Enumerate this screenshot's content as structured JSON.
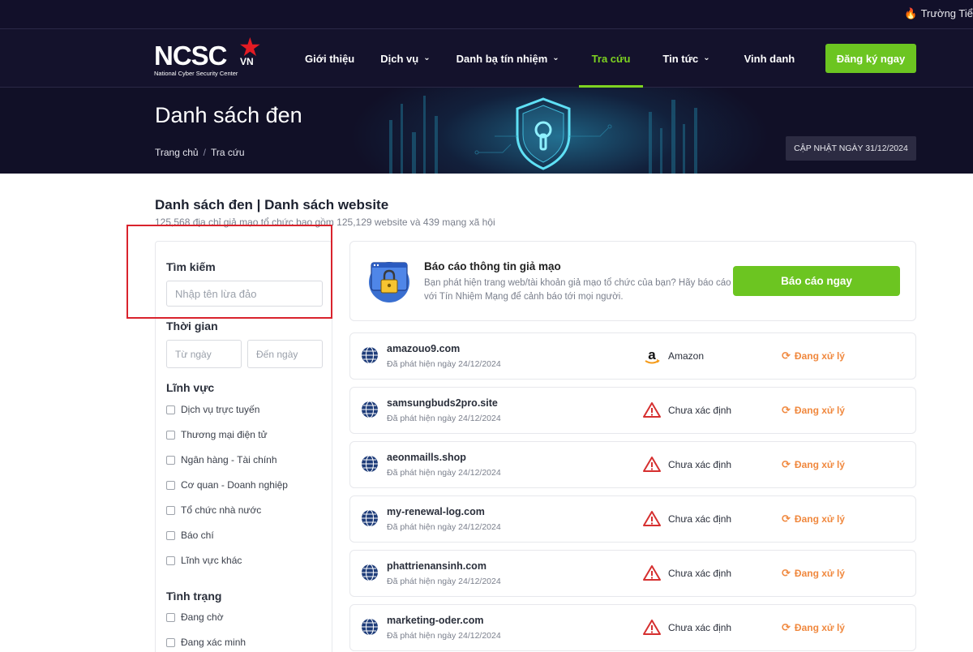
{
  "ticker": {
    "text": "Trường Tiể"
  },
  "logo": {
    "brand": "NCSC",
    "suffix": "VN",
    "tagline": "National Cyber Security Center"
  },
  "nav": {
    "items": [
      {
        "label": "Giới thiệu",
        "has_dropdown": false,
        "active": false
      },
      {
        "label": "Dịch vụ",
        "has_dropdown": true,
        "active": false
      },
      {
        "label": "Danh bạ tín nhiệm",
        "has_dropdown": true,
        "active": false
      },
      {
        "label": "Tra cứu",
        "has_dropdown": false,
        "active": true
      },
      {
        "label": "Tin tức",
        "has_dropdown": true,
        "active": false
      },
      {
        "label": "Vinh danh",
        "has_dropdown": false,
        "active": false
      }
    ],
    "signup_label": "Đăng ký ngay"
  },
  "hero": {
    "title": "Danh sách đen",
    "breadcrumb": [
      "Trang chủ",
      "/",
      "Tra cứu"
    ],
    "update_badge": "CẬP NHẬT NGÀY 31/12/2024"
  },
  "section": {
    "title": "Danh sách đen | Danh sách website",
    "subtitle": "125,568 địa chỉ giả mạo tổ chức bao gồm 125,129 website và 439 mạng xã hội"
  },
  "filters": {
    "search_label": "Tìm kiếm",
    "search_placeholder": "Nhập tên lừa đảo",
    "time_label": "Thời gian",
    "from_placeholder": "Từ ngày",
    "to_placeholder": "Đến ngày",
    "field_label": "Lĩnh vực",
    "fields": [
      "Dịch vụ trực tuyến",
      "Thương mại điện tử",
      "Ngân hàng - Tài chính",
      "Cơ quan - Doanh nghiệp",
      "Tổ chức nhà nước",
      "Báo chí",
      "Lĩnh vực khác"
    ],
    "status_label": "Tình trạng",
    "statuses": [
      "Đang chờ",
      "Đang xác minh"
    ]
  },
  "report": {
    "title": "Báo cáo thông tin giả mạo",
    "description": "Bạn phát hiện trang web/tài khoản giả mạo tổ chức của bạn? Hãy báo cáo với Tín Nhiệm Mạng để cảnh báo tới mọi người.",
    "button": "Báo cáo ngay"
  },
  "entries": [
    {
      "domain": "amazouo9.com",
      "date": "Đã phát hiện ngày 24/12/2024",
      "org": "Amazon",
      "org_icon": "amazon-icon",
      "status": "Đang xử lý"
    },
    {
      "domain": "samsungbuds2pro.site",
      "date": "Đã phát hiện ngày 24/12/2024",
      "org": "Chưa xác định",
      "org_icon": "warning-icon",
      "status": "Đang xử lý"
    },
    {
      "domain": "aeonmaills.shop",
      "date": "Đã phát hiện ngày 24/12/2024",
      "org": "Chưa xác định",
      "org_icon": "warning-icon",
      "status": "Đang xử lý"
    },
    {
      "domain": "my-renewal-log.com",
      "date": "Đã phát hiện ngày 24/12/2024",
      "org": "Chưa xác định",
      "org_icon": "warning-icon",
      "status": "Đang xử lý"
    },
    {
      "domain": "phattrienansinh.com",
      "date": "Đã phát hiện ngày 24/12/2024",
      "org": "Chưa xác định",
      "org_icon": "warning-icon",
      "status": "Đang xử lý"
    },
    {
      "domain": "marketing-oder.com",
      "date": "Đã phát hiện ngày 24/12/2024",
      "org": "Chưa xác định",
      "org_icon": "warning-icon",
      "status": "Đang xử lý"
    }
  ],
  "colors": {
    "accent": "#6cc521",
    "nav_bg": "#14122c",
    "status": "#f0883e",
    "highlight": "#d9232d"
  }
}
